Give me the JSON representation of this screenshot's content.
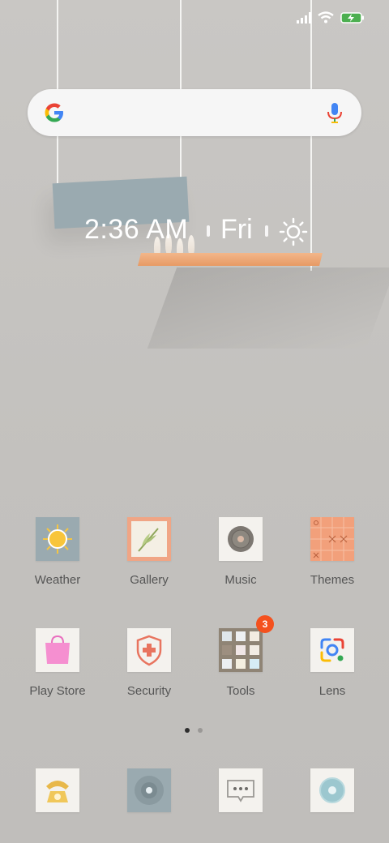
{
  "clock": {
    "time": "2:36 AM",
    "day": "Fri"
  },
  "search": {
    "google_icon": "google-g-icon",
    "mic_icon": "mic-icon"
  },
  "status": {
    "signal": "signal-icon",
    "wifi": "wifi-icon",
    "battery": "battery-charging-icon"
  },
  "apps_row1": [
    {
      "label": "Weather",
      "icon": "weather-sun-icon"
    },
    {
      "label": "Gallery",
      "icon": "gallery-leaf-icon"
    },
    {
      "label": "Music",
      "icon": "music-disc-icon"
    },
    {
      "label": "Themes",
      "icon": "themes-grid-icon"
    }
  ],
  "apps_row2": [
    {
      "label": "Play Store",
      "icon": "play-store-bag-icon"
    },
    {
      "label": "Security",
      "icon": "security-shield-icon"
    },
    {
      "label": "Tools",
      "icon": "tools-folder-icon",
      "badge": "3"
    },
    {
      "label": "Lens",
      "icon": "lens-icon"
    }
  ],
  "dock": [
    {
      "icon": "phone-icon"
    },
    {
      "icon": "camera-icon"
    },
    {
      "icon": "messages-icon"
    },
    {
      "icon": "browser-icon"
    }
  ],
  "page_indicator": {
    "pages": 2,
    "current": 1
  }
}
